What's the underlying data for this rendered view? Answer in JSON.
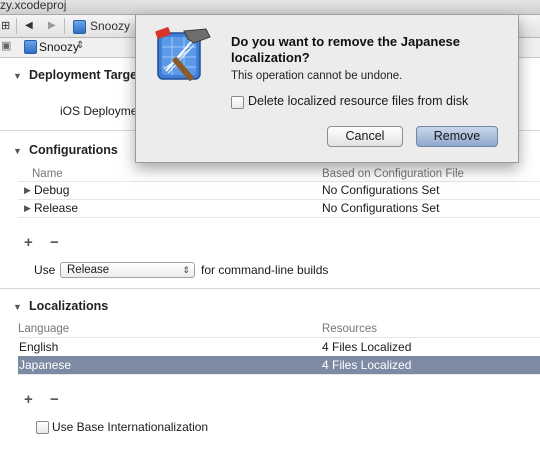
{
  "window": {
    "title": "zy.xcodeproj"
  },
  "jumpbar": {
    "project_name": "Snoozy"
  },
  "target_selector": {
    "value": "Snoozy"
  },
  "deployment_target": {
    "section_title": "Deployment Target",
    "ios_label": "iOS Deploymen"
  },
  "configurations": {
    "section_title": "Configurations",
    "columns": {
      "name": "Name",
      "based_on": "Based on Configuration File"
    },
    "rows": [
      {
        "name": "Debug",
        "based_on": "No Configurations Set"
      },
      {
        "name": "Release",
        "based_on": "No Configurations Set"
      }
    ],
    "use_label": "Use",
    "use_value": "Release",
    "use_suffix": "for command-line builds"
  },
  "localizations": {
    "section_title": "Localizations",
    "columns": {
      "language": "Language",
      "resources": "Resources"
    },
    "rows": [
      {
        "language": "English",
        "resources": "4 Files Localized",
        "selected": false
      },
      {
        "language": "Japanese",
        "resources": "4 Files Localized",
        "selected": true
      }
    ],
    "use_base_label": "Use Base Internationalization"
  },
  "dialog": {
    "title": "Do you want to remove the Japanese localization?",
    "message": "This operation cannot be undone.",
    "checkbox_label": "Delete localized resource files from disk",
    "cancel_label": "Cancel",
    "remove_label": "Remove",
    "icon": "xcode-hammer-icon"
  },
  "glyphs": {
    "plus": "+",
    "minus": "−",
    "disclosure_open": "▼",
    "disclosure_closed": "▶",
    "nav_back": "◀",
    "nav_forward": "▶",
    "popup_arrows": "⇕",
    "grid": "⊞",
    "sidebar": "▣"
  },
  "colors": {
    "selection": "#7c8ba3",
    "default_button": "#8ea8cc"
  }
}
